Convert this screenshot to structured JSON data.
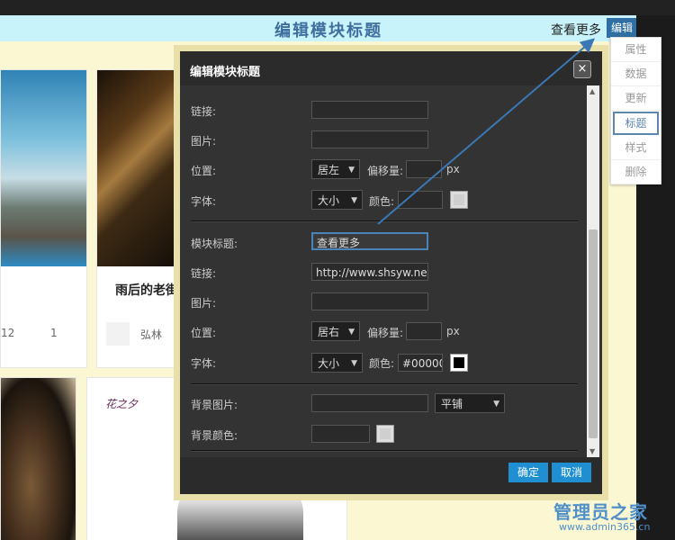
{
  "page": {
    "title": "编辑模块标题",
    "more_link": "查看更多",
    "edit_button": "编辑"
  },
  "context_menu": {
    "items": [
      {
        "label": "属性"
      },
      {
        "label": "数据"
      },
      {
        "label": "更新"
      },
      {
        "label": "标题"
      },
      {
        "label": "样式"
      },
      {
        "label": "删除"
      }
    ],
    "active_index": 3
  },
  "cards": {
    "card2_title": "雨后的老街",
    "card1_stats": [
      "12",
      "1"
    ],
    "card2_author": "弘林",
    "card3_logo": "花之夕"
  },
  "dialog": {
    "title": "编辑模块标题",
    "close": "×",
    "section1": {
      "link_label": "链接:",
      "link_value": "",
      "image_label": "图片:",
      "image_value": "",
      "position_label": "位置:",
      "position_value": "居左",
      "offset_label": "偏移量:",
      "offset_unit": "px",
      "font_label": "字体:",
      "font_value": "大小",
      "color_label": "颜色:",
      "color_value": ""
    },
    "section2": {
      "module_title_label": "模块标题:",
      "module_title_value": "查看更多",
      "link_label": "链接:",
      "link_value": "http://www.shsyw.ne",
      "image_label": "图片:",
      "image_value": "",
      "position_label": "位置:",
      "position_value": "居右",
      "offset_label": "偏移量:",
      "offset_unit": "px",
      "font_label": "字体:",
      "font_value": "大小",
      "color_label": "颜色:",
      "color_value": "#00000"
    },
    "section3": {
      "bg_image_label": "背景图片:",
      "bg_image_value": "",
      "repeat_value": "平铺",
      "bg_color_label": "背景颜色:",
      "bg_color_value": ""
    },
    "confirm": "确定",
    "cancel": "取消"
  },
  "watermark": {
    "brand": "管理员之家",
    "url": "www.admin365.cn"
  },
  "colors": {
    "accent": "#2f6fa3",
    "button_blue": "#1f8fd2",
    "title_bar": "#c9f3fb",
    "page_bg": "#fbf7d3"
  }
}
